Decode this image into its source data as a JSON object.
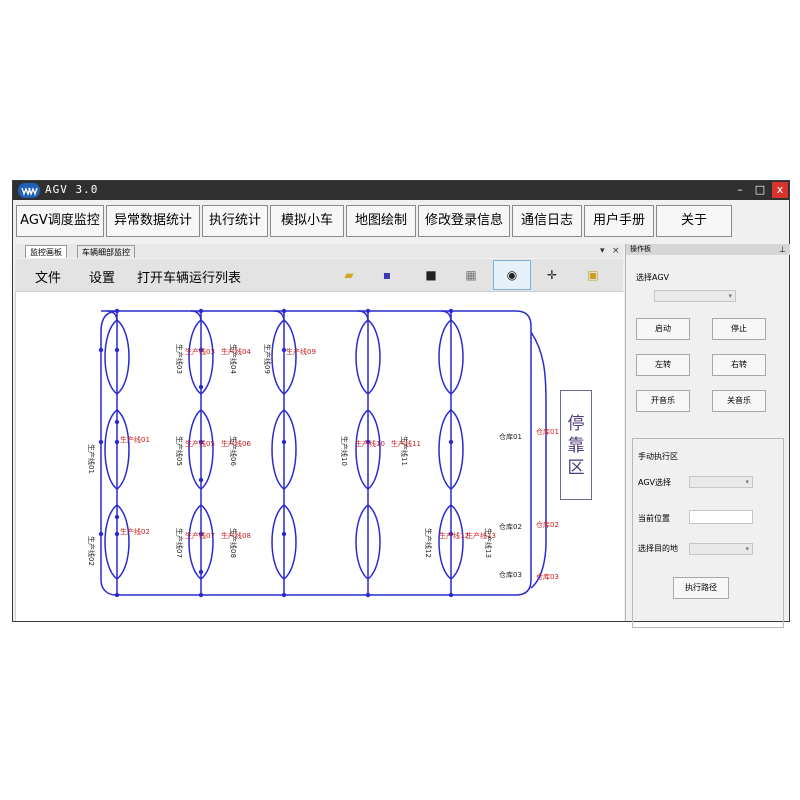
{
  "app": {
    "title": "AGV 3.0"
  },
  "window_controls": {
    "minimize": "–",
    "maximize": "□",
    "close": "x"
  },
  "menu": [
    {
      "label": "AGV调度监控"
    },
    {
      "label": "异常数据统计"
    },
    {
      "label": "执行统计"
    },
    {
      "label": "模拟小车"
    },
    {
      "label": "地图绘制"
    },
    {
      "label": "修改登录信息"
    },
    {
      "label": "通信日志"
    },
    {
      "label": "用户手册"
    },
    {
      "label": "关于"
    }
  ],
  "tabs": [
    {
      "label": "监控画板"
    },
    {
      "label": "车辆细部监控"
    }
  ],
  "tab_controls": {
    "dropdown": "▾",
    "close": "×"
  },
  "toolbar": {
    "file": "文件",
    "settings": "设置",
    "open_list": "打开车辆运行列表",
    "icons": [
      "folder-open-icon",
      "save-icon",
      "stop-icon",
      "grid-icon",
      "eye-icon",
      "move-icon",
      "lock-icon"
    ]
  },
  "map": {
    "route_color": "#2a2ad0",
    "label_color": "#c81e1e",
    "production_lines": [
      "生产线01",
      "生产线02",
      "生产线03",
      "生产线04",
      "生产线05",
      "生产线06",
      "生产线07",
      "生产线08",
      "生产线09",
      "生产线10",
      "生产线11",
      "生产线12",
      "生产线13"
    ],
    "vertical_names": [
      "生产线01",
      "生产线02",
      "生产线03",
      "生产线04",
      "生产线05",
      "生产线06",
      "生产线07",
      "生产线08",
      "生产线09",
      "生产线10",
      "生产线11",
      "生产线12",
      "生产线13"
    ],
    "warehouses": [
      "仓库01",
      "仓库02",
      "仓库03"
    ],
    "parking_area": "停靠区"
  },
  "ops_panel": {
    "title": "操作板",
    "pin": "⊥",
    "select_agv_label": "选择AGV",
    "buttons": {
      "start": "启动",
      "stop": "停止",
      "left": "左转",
      "right": "右转",
      "music_on": "开音乐",
      "music_off": "关音乐"
    },
    "manual_group": "手动执行区",
    "agv_select_label": "AGV选择",
    "current_position_label": "当前位置",
    "destination_label": "选择目的地",
    "execute_button": "执行路径"
  }
}
